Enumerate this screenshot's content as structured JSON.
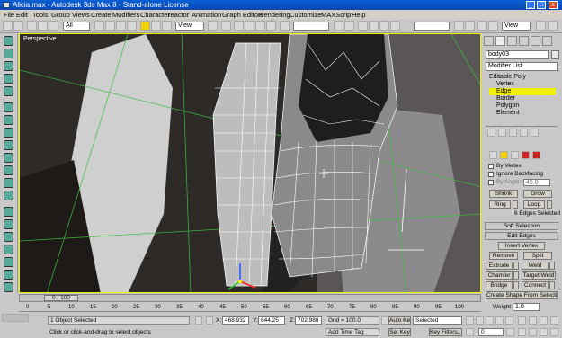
{
  "window": {
    "title": "Alicia.max - Autodesk 3ds Max 8 - Stand-alone License",
    "min": "_",
    "max": "□",
    "close": "x"
  },
  "menu": [
    "File",
    "Edit",
    "Tools",
    "Group",
    "Views",
    "Create",
    "Modifiers",
    "Character",
    "reactor",
    "Animation",
    "Graph Editors",
    "Rendering",
    "Customize",
    "MAXScript",
    "Help"
  ],
  "toolbar": {
    "selection_filter": "All",
    "ref_coord": "View",
    "named_sel": "",
    "view_dropdown": "View"
  },
  "viewport": {
    "label": "Perspective"
  },
  "command_panel": {
    "object_name": "body03",
    "modifier_list": "Modifier List",
    "stack": [
      "Editable Poly",
      "Vertex",
      "Edge",
      "Border",
      "Polygon",
      "Element"
    ],
    "selection": {
      "by_vertex": "By Vertex",
      "ignore_backfacing": "Ignore Backfacing",
      "by_angle": "By Angle:",
      "angle_value": "45.0",
      "shrink": "Shrink",
      "grow": "Grow",
      "ring": "Ring",
      "loop": "Loop",
      "status": "6 Edges Selected"
    },
    "soft_selection": "Soft Selection",
    "edit_edges": "Edit Edges",
    "insert_vertex": "Insert Vertex",
    "remove": "Remove",
    "split": "Split",
    "extrude": "Extrude",
    "weld": "Weld",
    "chamfer": "Chamfer",
    "target_weld": "Target Weld",
    "bridge": "Bridge",
    "connect": "Connect",
    "create_shape": "Create Shape From Selection",
    "weight_label": "Weight:",
    "weight_value": "1.0"
  },
  "timeline": {
    "slider": "0 / 100",
    "ticks": [
      "0",
      "5",
      "10",
      "15",
      "20",
      "25",
      "30",
      "35",
      "40",
      "45",
      "50",
      "55",
      "60",
      "65",
      "70",
      "75",
      "80",
      "85",
      "90",
      "95",
      "100"
    ]
  },
  "status": {
    "objects": "1 Object Selected",
    "prompt": "Click or click-and-drag to select objects",
    "x_label": "X:",
    "x": "468.932",
    "y_label": "Y:",
    "y": "844.25",
    "z_label": "Z:",
    "z": "702.988",
    "grid": "Grid = 100.0",
    "add_time_tag": "Add Time Tag",
    "auto_key": "Auto Key",
    "set_key": "Set Key",
    "selected": "Selected",
    "key_filters": "Key Filters...",
    "frame": "0"
  }
}
